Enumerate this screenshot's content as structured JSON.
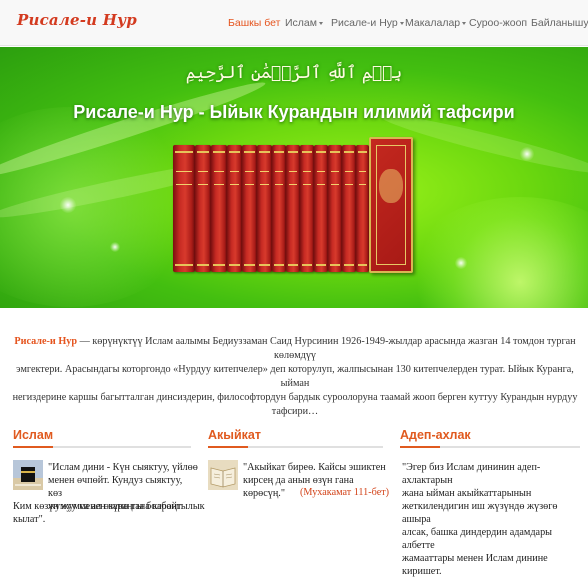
{
  "navbar": {
    "brand": "Рисале-и Нур",
    "items": [
      {
        "label": "Башкы бет",
        "active": true,
        "dropdown": false
      },
      {
        "label": "Ислам",
        "active": false,
        "dropdown": true
      },
      {
        "label": "Рисале-и Нур",
        "active": false,
        "dropdown": true
      },
      {
        "label": "Макалалар",
        "active": false,
        "dropdown": true
      },
      {
        "label": "Суроо-жооп",
        "active": false,
        "dropdown": false
      },
      {
        "label": "Байланышуу",
        "active": false,
        "dropdown": false
      }
    ]
  },
  "hero": {
    "bismillah": "بِسۡمِ ٱللَّهِ ٱلرَّحۡمَٰنِ ٱلرَّحِيمِ",
    "title": "Рисале-и Нур - Ыйык Курандын илимий тафсири",
    "books_image": "risale-i-nur-book-set"
  },
  "intro": {
    "lead": "Рисале-и Нур",
    "line1": " — көрүнүктүү Ислам аалымы Бедиуззаман Саид Нурсинин 1926-1949-жылдар арасында жазган 14 томдон турган көлөмдүү",
    "line2": "эмгектери. Арасындагы которгондо «Нурдуу китепчелер» деп которулуп, жалпысынан 130 китепчелерден турат. Ыйык Куранга, ыйман",
    "line3": "негиздерине каршы багытталган динсиздерин, философтордун бардык суроолоруна таамай жооп берген куттуу Курандын нурдуу",
    "line4": "тафсири…"
  },
  "columns": [
    {
      "heading": "Ислам",
      "thumb": "kaaba-thumbnail",
      "quote_lines": [
        "\"Ислам дини - Күн сыяктуу, үйлөө",
        "менен өчпөйт. Кундуз сыяктуу, көз",
        "жумуу менен караңгы болбойт."
      ],
      "quote_tail": [
        "Ким көзүн жумса ал өзүнө гана караңгылык",
        "кылат\"."
      ],
      "source": ""
    },
    {
      "heading": "Акыйкат",
      "thumb": "book-thumbnail",
      "quote_lines": [
        "\"Акыйкат биреө. Кайсы эшиктен",
        "кирсең да анын өзүн гана көрөсүң.\""
      ],
      "quote_tail": [],
      "source": "(Мухакамат 111-бет)"
    },
    {
      "heading": "Адеп-ахлак",
      "thumb": "",
      "quote_lines": [
        "\"Эгер биз Ислам дининин адеп-ахлактарын",
        "жана ыйман акыйкаттарынын",
        "жеткилендигин иш жүзүндө жүзөгө ашыра",
        "алсак, башка диндердин адамдары албетте",
        "жамааттары менен Ислам динине киришет."
      ],
      "quote_tail": [],
      "source": ""
    }
  ],
  "colors": {
    "accent": "#e05a1f",
    "brand": "#d33a1f",
    "hero_green": "#55c812"
  }
}
